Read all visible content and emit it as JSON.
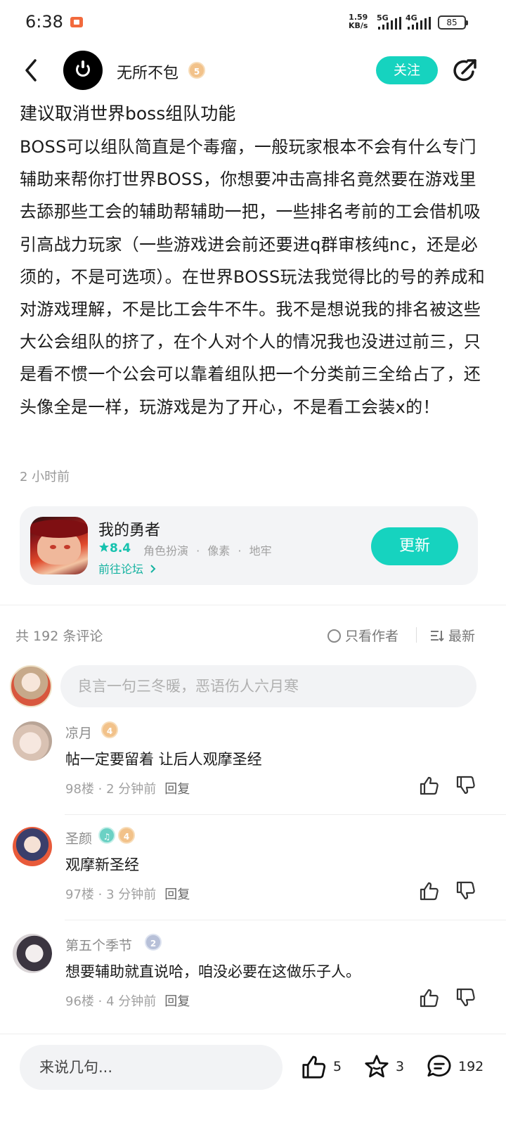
{
  "status_bar": {
    "time": "6:38",
    "speed_value": "1.59",
    "speed_unit": "KB/s",
    "net1": "5G",
    "net2": "4G",
    "battery": "85"
  },
  "header": {
    "author_name": "无所不包",
    "author_level": "5",
    "follow_label": "关注"
  },
  "post": {
    "title": "建议取消世界boss组队功能",
    "body": "BOSS可以组队简直是个毒瘤，一般玩家根本不会有什么专门辅助来帮你打世界BOSS，你想要冲击高排名竟然要在游戏里去舔那些工会的辅助帮辅助一把，一些排名考前的工会借机吸引高战力玩家（一些游戏进会前还要进q群审核纯nc，还是必须的，不是可选项）。在世界BOSS玩法我觉得比的号的养成和对游戏理解，不是比工会牛不牛。我不是想说我的排名被这些大公会组队的挤了，在个人对个人的情况我也没进过前三，只是看不惯一个公会可以靠着组队把一个分类前三全给占了，还头像全是一样，玩游戏是为了开心，不是看工会装x的！",
    "time": "2 小时前"
  },
  "game_card": {
    "name": "我的勇者",
    "rating": "8.4",
    "tags": [
      "角色扮演",
      "像素",
      "地牢"
    ],
    "forum_link": "前往论坛",
    "update_label": "更新"
  },
  "comments_header": {
    "count_text": "共 192 条评论",
    "only_author_label": "只看作者",
    "sort_label": "最新",
    "input_placeholder": "良言一句三冬暖，恶语伤人六月寒"
  },
  "comments": [
    {
      "name": "凉月",
      "level": "4",
      "text": "帖一定要留着 让后人观摩圣经",
      "floor": "98楼",
      "time": "2 分钟前",
      "reply": "回复"
    },
    {
      "name": "圣颜",
      "level": "4",
      "text": "观摩新圣经",
      "floor": "97楼",
      "time": "3 分钟前",
      "reply": "回复"
    },
    {
      "name": "第五个季节",
      "level": "2",
      "text": "想要辅助就直说哈，咱没必要在这做乐子人。",
      "floor": "96楼",
      "time": "4 分钟前",
      "reply": "回复"
    }
  ],
  "bottom_bar": {
    "input_placeholder": "来说几句...",
    "likes": "5",
    "favorites": "3",
    "comments": "192"
  },
  "colors": {
    "accent": "#16d3bf",
    "text": "#1a1a1a",
    "muted": "#999999"
  }
}
